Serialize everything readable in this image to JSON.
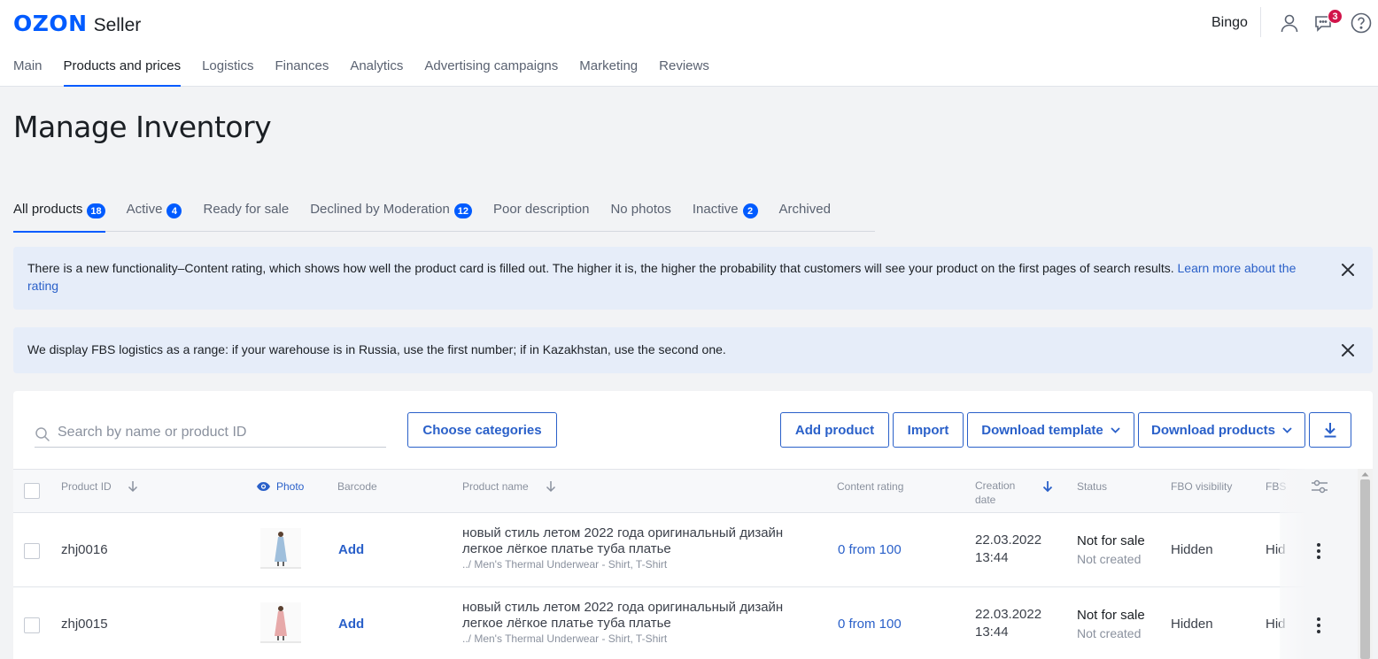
{
  "header": {
    "logo_brand": "OZON",
    "logo_suffix": "Seller",
    "user_name": "Bingo",
    "chat_badge": "3",
    "icons": [
      "profile-icon",
      "chat-icon",
      "help-icon"
    ]
  },
  "nav": [
    {
      "label": "Main"
    },
    {
      "label": "Products and prices",
      "active": true
    },
    {
      "label": "Logistics"
    },
    {
      "label": "Finances"
    },
    {
      "label": "Analytics"
    },
    {
      "label": "Advertising campaigns"
    },
    {
      "label": "Marketing"
    },
    {
      "label": "Reviews"
    }
  ],
  "page_title": "Manage Inventory",
  "tabs": [
    {
      "label": "All products",
      "count": "18",
      "active": true
    },
    {
      "label": "Active",
      "count": "4"
    },
    {
      "label": "Ready for sale",
      "count": ""
    },
    {
      "label": "Declined by Moderation",
      "count": "12"
    },
    {
      "label": "Poor description",
      "count": ""
    },
    {
      "label": "No photos",
      "count": ""
    },
    {
      "label": "Inactive",
      "count": "2"
    },
    {
      "label": "Archived",
      "count": ""
    }
  ],
  "notices": {
    "rating_text": "There is a new functionality–Content rating, which shows how well the product card is filled out. The higher it is, the higher the probability that customers will see your product on the first pages of search results.",
    "rating_link": "Learn more about the rating",
    "fbs_text": "We display FBS logistics as a range: if your warehouse is in Russia, use the first number; if in Kazakhstan, use the second one."
  },
  "toolbar": {
    "search_placeholder": "Search by name or product ID",
    "choose_categories": "Choose categories",
    "add_product": "Add product",
    "import": "Import",
    "download_template": "Download template",
    "download_products": "Download products"
  },
  "table": {
    "headers": {
      "product_id": "Product ID",
      "photo": "Photo",
      "barcode": "Barcode",
      "product_name": "Product name",
      "content_rating": "Content rating",
      "creation_date_1": "Creation",
      "creation_date_2": "date",
      "status": "Status",
      "fbo_visibility": "FBO visibility",
      "fbs_visibility": "FBS"
    },
    "rows": [
      {
        "id": "zhj0016",
        "barcode_action": "Add",
        "name_line1": "новый стиль летом 2022 года оригинальный дизайн",
        "name_line2": "легкое лёгкое платье туба платье",
        "category": "../ Men's Thermal Underwear - Shirt, T-Shirt",
        "rating": "0 from 100",
        "date": "22.03.2022",
        "time": "13:44",
        "status": "Not for sale",
        "substatus": "Not created",
        "fbo": "Hidden",
        "fbs": "Hid",
        "dress_color": "#9fbfdc"
      },
      {
        "id": "zhj0015",
        "barcode_action": "Add",
        "name_line1": "новый стиль летом 2022 года оригинальный дизайн",
        "name_line2": "легкое лёгкое платье туба платье",
        "category": "../ Men's Thermal Underwear - Shirt, T-Shirt",
        "rating": "0 from 100",
        "date": "22.03.2022",
        "time": "13:44",
        "status": "Not for sale",
        "substatus": "Not created",
        "fbo": "Hidden",
        "fbs": "Hid",
        "dress_color": "#e7a9a9"
      }
    ]
  }
}
